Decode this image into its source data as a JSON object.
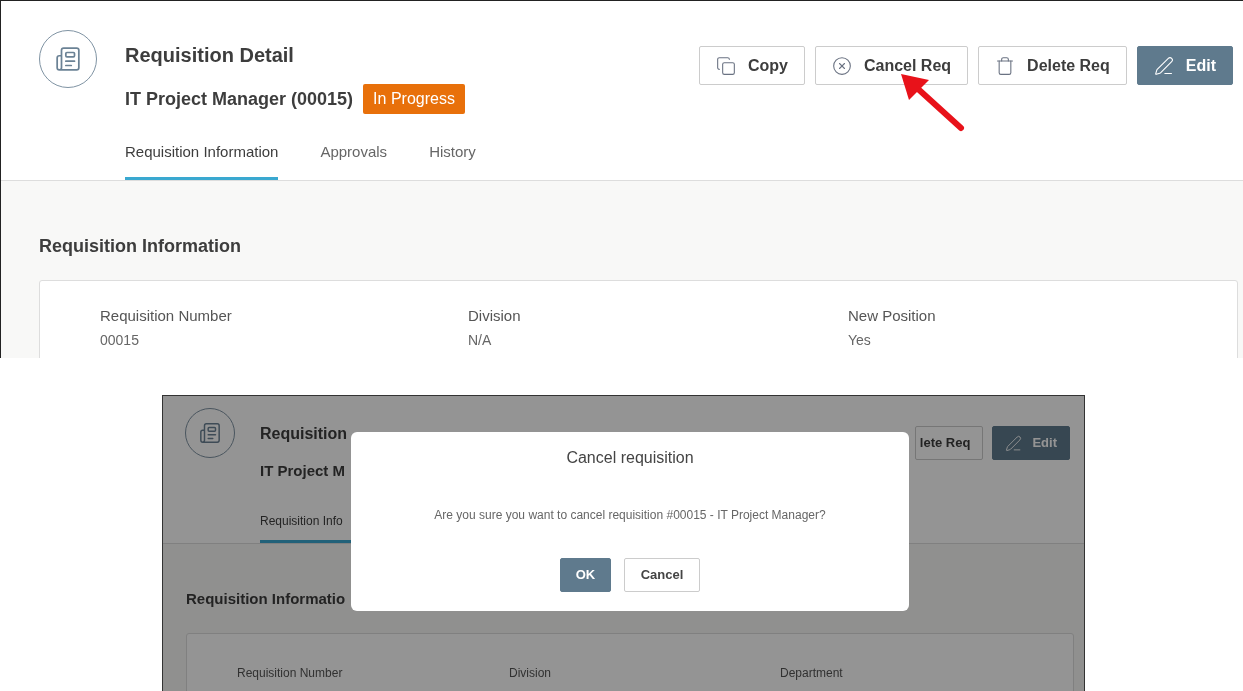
{
  "detail_page": {
    "title": "Requisition Detail",
    "subtitle": "IT Project Manager (00015)",
    "status_badge": "In Progress",
    "buttons": [
      {
        "label": "Copy",
        "kind": "copy"
      },
      {
        "label": "Cancel Req",
        "kind": "cancel"
      },
      {
        "label": "Delete Req",
        "kind": "delete"
      },
      {
        "label": "Edit",
        "kind": "edit"
      }
    ],
    "tabs": [
      {
        "label": "Requisition Information",
        "selected": true
      },
      {
        "label": "Approvals",
        "selected": false
      },
      {
        "label": "History",
        "selected": false
      }
    ],
    "section_title": "Requisition Information",
    "fields": [
      {
        "label": "Requisition Number",
        "value": "00015"
      },
      {
        "label": "Division",
        "value": "N/A"
      },
      {
        "label": "New Position",
        "value": "Yes"
      }
    ]
  },
  "dialog_view": {
    "background": {
      "title": "Requisition",
      "subtitle": "IT Project M",
      "buttons": [
        {
          "label": "lete Req",
          "kind": "delete"
        },
        {
          "label": "Edit",
          "kind": "edit"
        }
      ],
      "tabs": [
        {
          "label": "Requisition Info",
          "selected": true
        }
      ],
      "section_title": "Requisition Informatio",
      "fields": [
        {
          "label": "Requisition Number"
        },
        {
          "label": "Division"
        },
        {
          "label": "Department"
        }
      ]
    },
    "dialog": {
      "title": "Cancel requisition",
      "message": "Are you sure you want to cancel requisition #00015 - IT Project Manager?",
      "buttons": [
        {
          "label": "OK",
          "kind": "primary"
        },
        {
          "label": "Cancel",
          "kind": "secondary"
        }
      ]
    }
  }
}
